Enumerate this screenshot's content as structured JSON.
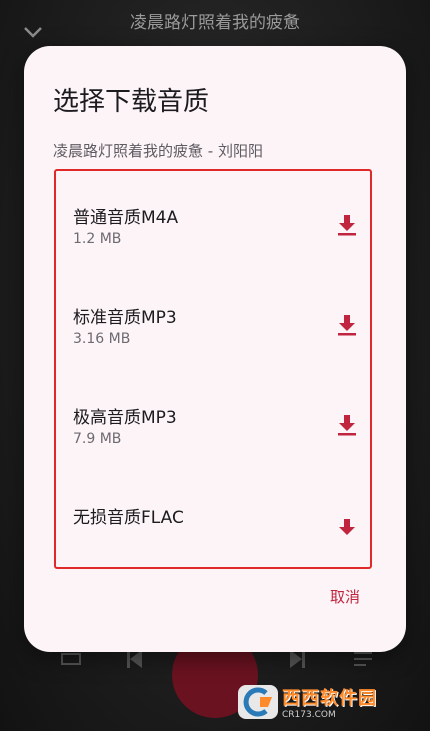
{
  "player": {
    "song_title": "凌晨路灯照着我的疲惫",
    "collapse_icon": "chevron-down-icon"
  },
  "dialog": {
    "title": "选择下载音质",
    "subtitle": "凌晨路灯照着我的疲惫 - 刘阳阳",
    "options": [
      {
        "name": "普通音质M4A",
        "size": "1.2 MB",
        "icon": "download-icon"
      },
      {
        "name": "标准音质MP3",
        "size": "3.16 MB",
        "icon": "download-icon"
      },
      {
        "name": "极高音质MP3",
        "size": "7.9 MB",
        "icon": "download-icon"
      },
      {
        "name": "无损音质FLAC",
        "size": "",
        "icon": "download-icon"
      }
    ],
    "cancel_label": "取消",
    "accent_color": "#c0243f",
    "highlight_border_color": "#e02a2a"
  },
  "watermark": {
    "main": "西西软件园",
    "sub": "CR173.COM"
  }
}
